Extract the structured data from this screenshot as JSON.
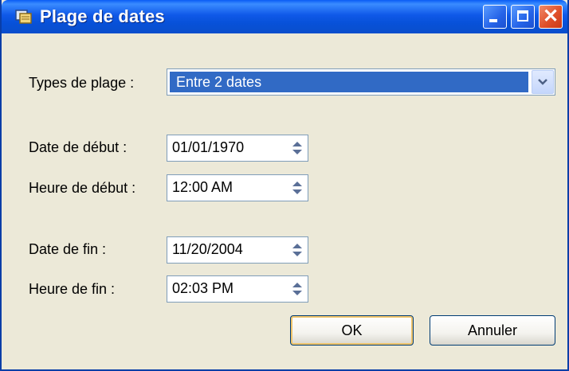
{
  "window": {
    "title": "Plage de dates",
    "icon": "app-icon"
  },
  "titlebar_buttons": {
    "minimize": "minimize-icon",
    "maximize": "maximize-icon",
    "close": "close-icon",
    "close_glyph": "✕"
  },
  "form": {
    "range_type": {
      "label": "Types de plage :",
      "value": "Entre 2 dates"
    },
    "start_date": {
      "label": "Date de début :",
      "value": "01/01/1970"
    },
    "start_time": {
      "label": "Heure de début :",
      "value": "12:00 AM"
    },
    "end_date": {
      "label": "Date de fin :",
      "value": "11/20/2004"
    },
    "end_time": {
      "label": "Heure de fin :",
      "value": "02:03 PM"
    }
  },
  "buttons": {
    "ok": "OK",
    "cancel": "Annuler"
  },
  "colors": {
    "titlebar": "#0a5cf5",
    "selection": "#316ac5",
    "window_bg": "#ece9d8",
    "close": "#e0502a"
  }
}
